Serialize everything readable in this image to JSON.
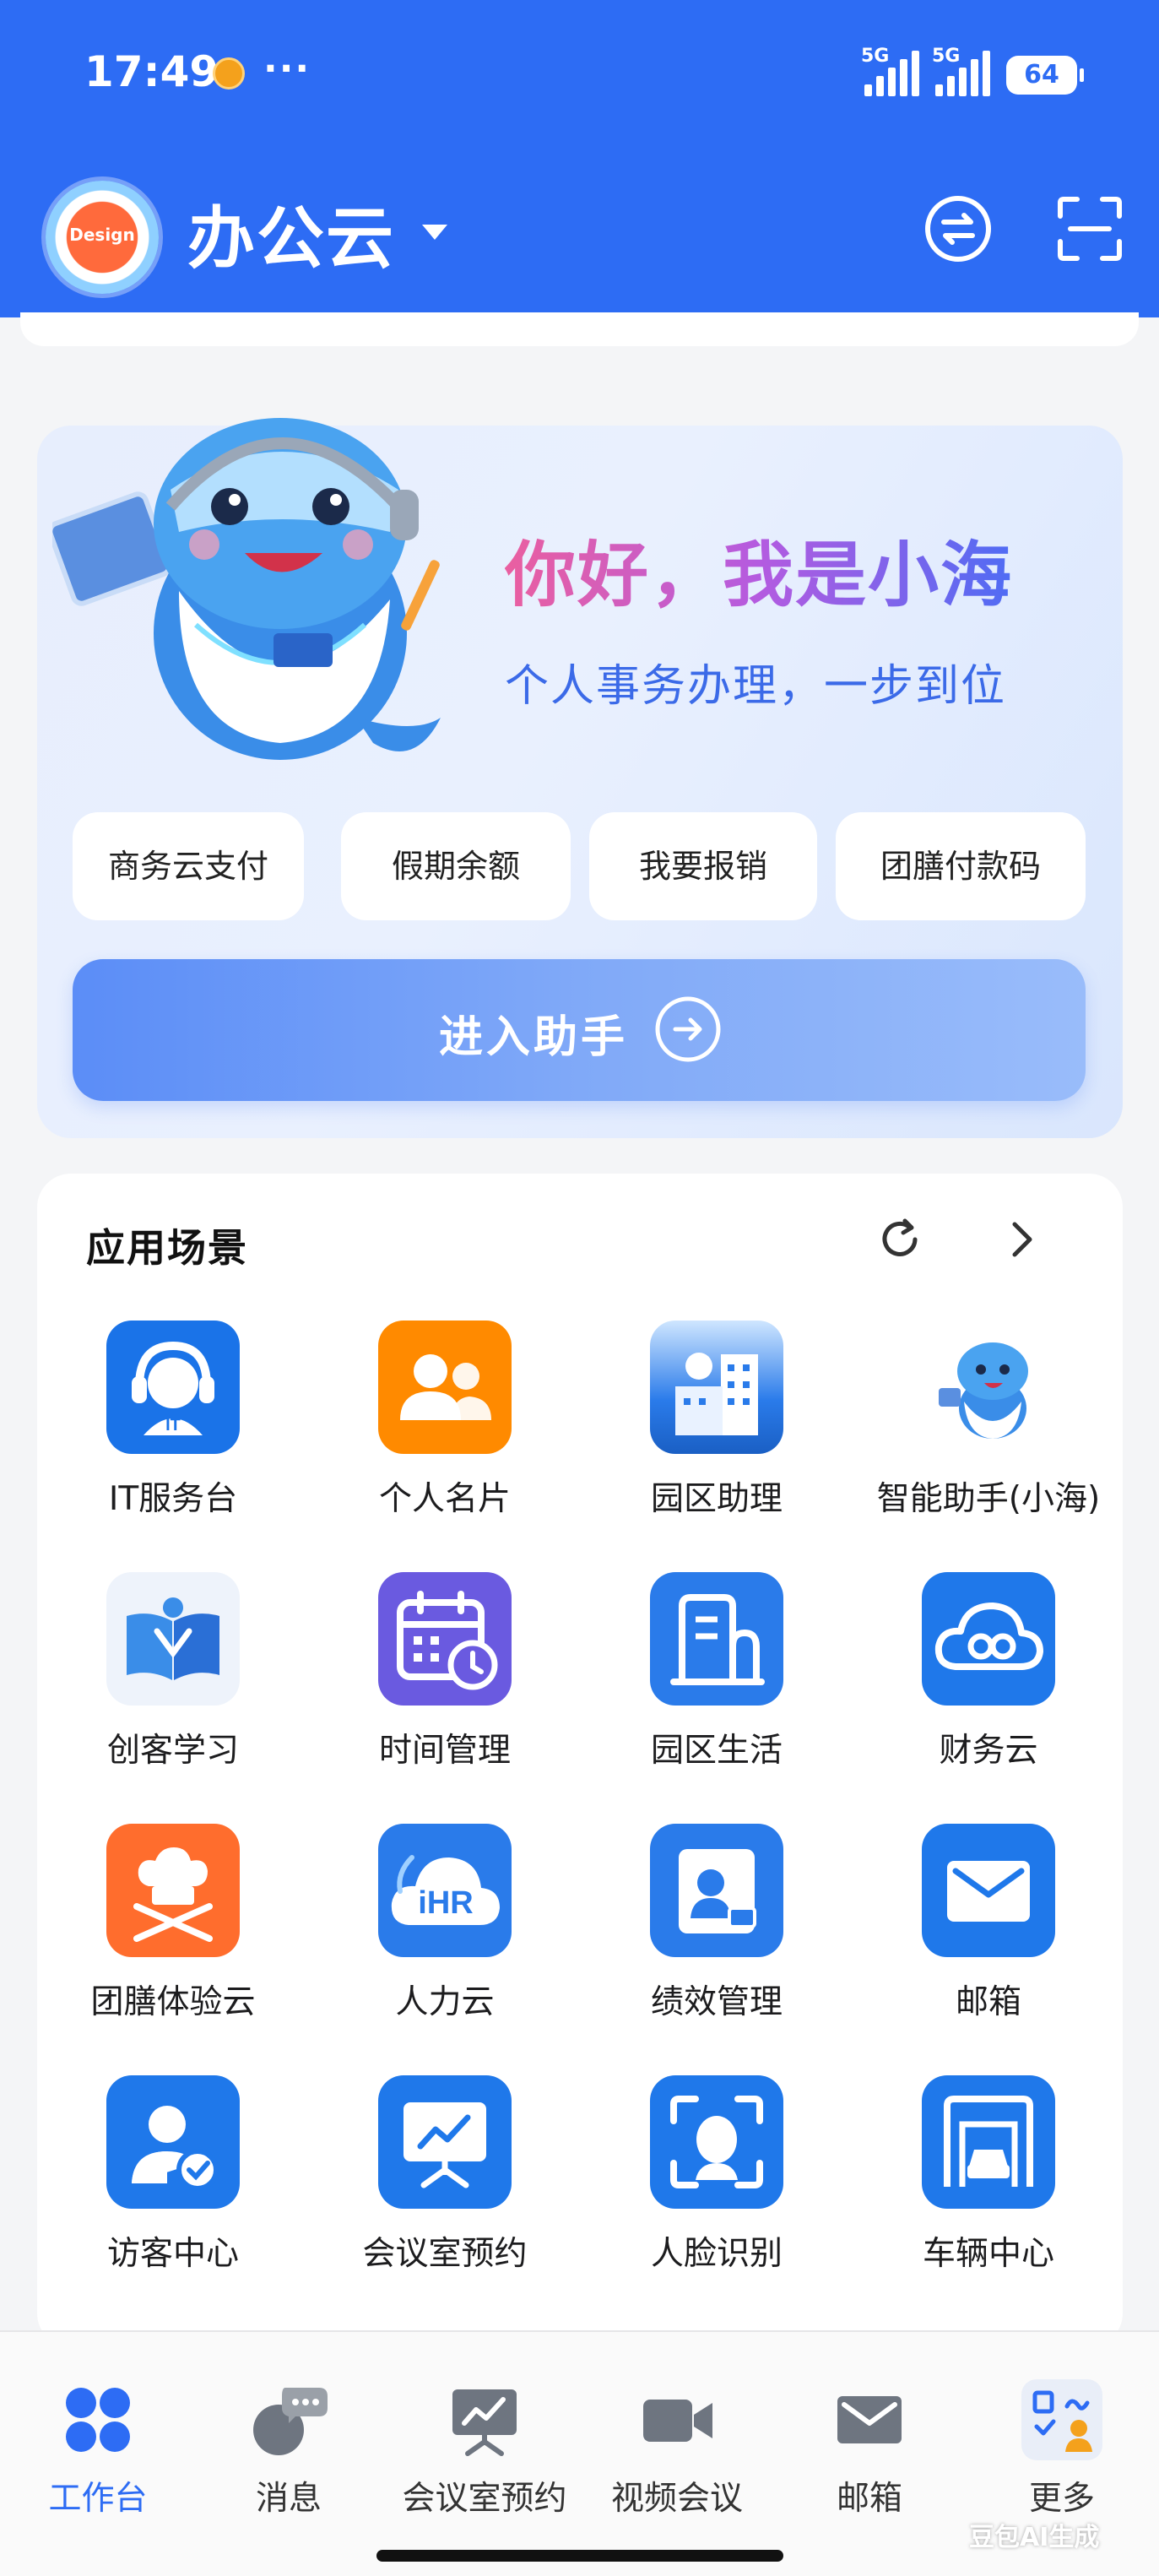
{
  "status_bar": {
    "time": "17:49",
    "more": "···",
    "signal_1": "5G",
    "signal_2": "5G",
    "battery": "64"
  },
  "header": {
    "logo_text": "Design",
    "title": "办公云",
    "switch_icon": "switch-icon",
    "scan_icon": "scan-icon",
    "color": "#2d6cf4"
  },
  "assistant": {
    "greeting": "你好，我是小海",
    "tagline": "个人事务办理，一步到位",
    "quick_actions": [
      "商务云支付",
      "假期余额",
      "我要报销",
      "团膳付款码"
    ],
    "enter_label": "进入助手"
  },
  "scenes": {
    "title": "应用场景",
    "apps": [
      {
        "label": "IT服务台",
        "icon": "headset-icon",
        "color": "#1a73e8"
      },
      {
        "label": "个人名片",
        "icon": "contacts-icon",
        "color": "#ff8a00"
      },
      {
        "label": "园区助理",
        "icon": "campus-building-icon",
        "color": "#1a6fd6"
      },
      {
        "label": "智能助手(小海)",
        "icon": "mascot-icon",
        "color": "#ffffff"
      },
      {
        "label": "创客学习",
        "icon": "open-book-icon",
        "color": "#eef3fb"
      },
      {
        "label": "时间管理",
        "icon": "calendar-clock-icon",
        "color": "#6a5ae0"
      },
      {
        "label": "园区生活",
        "icon": "building-icon",
        "color": "#2a7bea"
      },
      {
        "label": "财务云",
        "icon": "cloud-icon",
        "color": "#1f78ea"
      },
      {
        "label": "团膳体验云",
        "icon": "chef-icon",
        "color": "#ff6d2d"
      },
      {
        "label": "人力云",
        "icon": "ihr-cloud-icon",
        "color": "#2a7bea"
      },
      {
        "label": "绩效管理",
        "icon": "profile-card-icon",
        "color": "#2a7bea"
      },
      {
        "label": "邮箱",
        "icon": "mail-icon",
        "color": "#1f78ea"
      },
      {
        "label": "访客中心",
        "icon": "visitor-icon",
        "color": "#1f78ea"
      },
      {
        "label": "会议室预约",
        "icon": "presentation-icon",
        "color": "#1f78ea"
      },
      {
        "label": "人脸识别",
        "icon": "face-scan-icon",
        "color": "#1f78ea"
      },
      {
        "label": "车辆中心",
        "icon": "garage-car-icon",
        "color": "#1f78ea"
      }
    ]
  },
  "bottom_nav": {
    "items": [
      {
        "label": "工作台",
        "icon": "grid-icon",
        "active": true
      },
      {
        "label": "消息",
        "icon": "chat-icon",
        "active": false
      },
      {
        "label": "会议室预约",
        "icon": "presentation-icon",
        "active": false
      },
      {
        "label": "视频会议",
        "icon": "video-camera-icon",
        "active": false
      },
      {
        "label": "邮箱",
        "icon": "mail-icon",
        "active": false
      },
      {
        "label": "更多",
        "icon": "more-apps-icon",
        "active": false
      }
    ],
    "accent": "#2d6cf4",
    "watermark": "豆包AI生成"
  }
}
